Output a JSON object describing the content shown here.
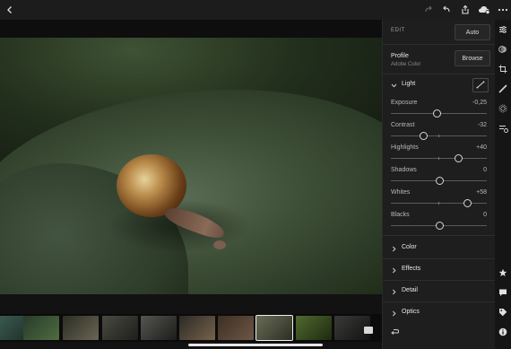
{
  "top_toolbar": {
    "icons": [
      "back-icon",
      "redo-icon",
      "undo-icon",
      "share-icon",
      "cloud-sync-icon",
      "more-icon"
    ]
  },
  "edit_panel": {
    "header": "EDIT",
    "auto_label": "Auto",
    "profile": {
      "label": "Profile",
      "value": "Adobe Color",
      "browse_label": "Browse"
    },
    "light": {
      "title": "Light",
      "expanded": true,
      "sliders": [
        {
          "label": "Exposure",
          "value": "-0,25",
          "level": 0.48
        },
        {
          "label": "Contrast",
          "value": "-32",
          "level": 0.34
        },
        {
          "label": "Highlights",
          "value": "+40",
          "level": 0.7
        },
        {
          "label": "Shadows",
          "value": "0",
          "level": 0.5
        },
        {
          "label": "Whites",
          "value": "+58",
          "level": 0.79
        },
        {
          "label": "Blacks",
          "value": "0",
          "level": 0.5
        }
      ]
    },
    "collapsed_sections": [
      "Color",
      "Effects",
      "Detail",
      "Optics"
    ]
  },
  "right_rail": {
    "icons": [
      "edit-sliders-icon",
      "presets-icon",
      "crop-icon",
      "healing-brush-icon",
      "radial-filter-icon",
      "selective-adjust-icon",
      "star-icon",
      "comment-icon",
      "tag-icon",
      "info-icon"
    ]
  },
  "colors": {
    "accent": "#e6e6e6",
    "panel_bg": "#1e1e1e",
    "app_bg": "#121212"
  }
}
